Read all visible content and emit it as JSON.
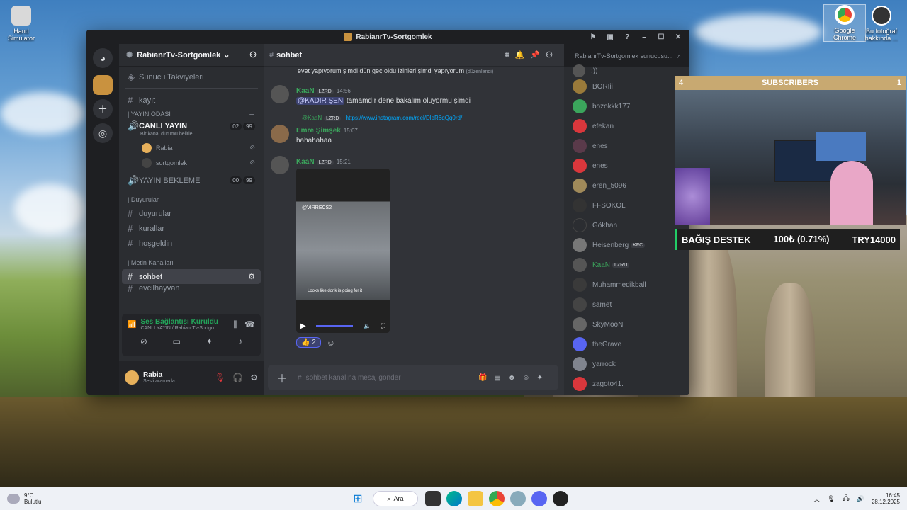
{
  "desktop": {
    "icons": [
      {
        "label": "Hand Simulator"
      },
      {
        "label": "Google Chrome"
      },
      {
        "label": "Bu fotoğraf hakkında ..."
      }
    ]
  },
  "window": {
    "title": "RabianrTv-Sortgomlek"
  },
  "server": {
    "name": "RabianrTv-Sortgomlek",
    "boosts": "Sunucu Takviyeleri"
  },
  "channels": {
    "kayit": "kayıt",
    "cat_yayin": "| YAYIN ODASI",
    "canli": "CANLI YAYIN",
    "canli_badge1": "02",
    "canli_badge2": "99",
    "status_hint": "Bir kanal durumu belirle",
    "voice_users": [
      "Rabia",
      "sortgomlek"
    ],
    "bekleme": "YAYIN BEKLEME",
    "bekleme_b1": "00",
    "bekleme_b2": "99",
    "cat_duyurular": "| Duyurular",
    "duyurular": "duyurular",
    "kurallar": "kurallar",
    "hosgeldin": "hoşgeldin",
    "cat_metin": "| Metin Kanalları",
    "sohbet": "sohbet",
    "evcilhayvan": "evcilhayvan"
  },
  "voice": {
    "status": "Ses Bağlantısı Kuruldu",
    "detail": "CANLI YAYIN / RabianrTv-Sortgo..."
  },
  "user": {
    "name": "Rabia",
    "status": "Sesli aramada"
  },
  "chat": {
    "channel": "sohbet",
    "search_placeholder": "RabianrTv-Sortgomlek sunucusu...",
    "top_line": "evet yapıyorum şimdi dün geç oldu izinleri şimdi yapıyorum",
    "top_edited": "(düzenlendi)",
    "m1": {
      "author": "KaaN",
      "tag": "LZRD",
      "time": "14:56",
      "mention": "@KADIR ŞEN",
      "text": "tamamdır dene bakalım oluyormu şimdi"
    },
    "reply": {
      "author": "@KaaN",
      "tag": "LZRD",
      "link": "https://www.instagram.com/reel/DleR6qQq0rd/"
    },
    "m2": {
      "author": "Emre Şimşek",
      "time": "15:07",
      "text": "hahahahaa"
    },
    "m3": {
      "author": "KaaN",
      "tag": "LZRD",
      "time": "15:21",
      "video_watermark": "@VIRRECS2",
      "video_caption": "Looks like donk is going for it"
    },
    "reaction_count": "2",
    "composer_placeholder": "sohbet kanalına mesaj gönder"
  },
  "members": [
    {
      "name": ":))"
    },
    {
      "name": "BORIii"
    },
    {
      "name": "bozokkk177"
    },
    {
      "name": "efekan"
    },
    {
      "name": "enes"
    },
    {
      "name": "enes"
    },
    {
      "name": "eren_5096"
    },
    {
      "name": "FFSOKOL"
    },
    {
      "name": "Gökhan"
    },
    {
      "name": "Heisenberg",
      "tag": "KFC"
    },
    {
      "name": "KaaN",
      "tag": "LZRD"
    },
    {
      "name": "Muhammedikball"
    },
    {
      "name": "samet"
    },
    {
      "name": "SkyMooN"
    },
    {
      "name": "theGrave"
    },
    {
      "name": "yarrock"
    },
    {
      "name": "zagoto41."
    }
  ],
  "stream": {
    "sub_left": "4",
    "sub_title": "SUBSCRIBERS",
    "sub_right": "1",
    "donate_label": "BAĞIŞ DESTEK",
    "donate_amount": "100₺ (0.71%)",
    "donate_goal": "TRY14000"
  },
  "taskbar": {
    "weather_temp": "9°C",
    "weather_desc": "Bulutlu",
    "search": "Ara",
    "time": "16:45",
    "date": "28.12.2025"
  },
  "colors": {
    "accent": "#5865f2",
    "green": "#23a55a",
    "mod_green": "#3ba55c",
    "brand_blue": "#00a8fc"
  }
}
